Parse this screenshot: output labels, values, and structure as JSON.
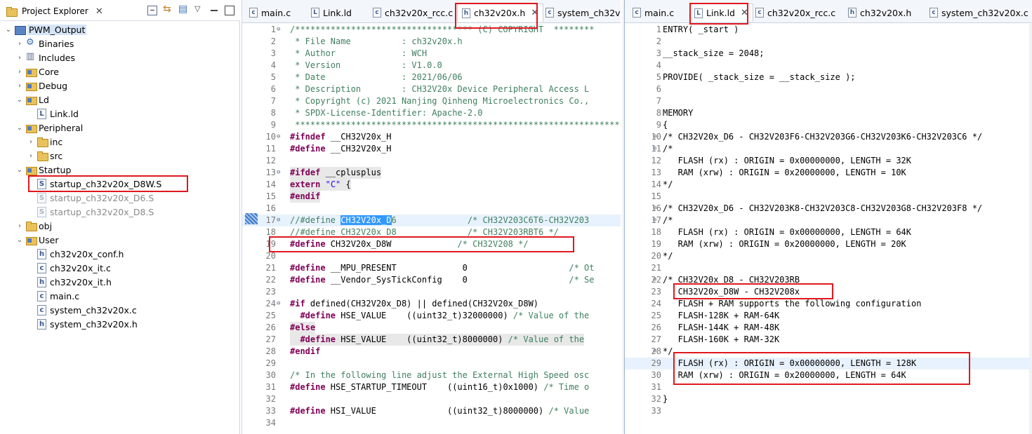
{
  "project_explorer": {
    "title": "Project Explorer",
    "close_glyph": "✕",
    "items": [
      {
        "label": "PWM_Output",
        "icon": "project-icon",
        "arrow": "⌄"
      },
      {
        "label": "Binaries",
        "icon": "binaries-icon",
        "arrow": "›"
      },
      {
        "label": "Includes",
        "icon": "includes-icon",
        "arrow": "›"
      },
      {
        "label": "Core",
        "icon": "source-folder-icon",
        "arrow": "›"
      },
      {
        "label": "Debug",
        "icon": "source-folder-icon",
        "arrow": "›"
      },
      {
        "label": "Ld",
        "icon": "source-folder-icon",
        "arrow": "⌄"
      },
      {
        "label": "Link.ld",
        "icon": "file-icon",
        "glyph": "L"
      },
      {
        "label": "Peripheral",
        "icon": "source-folder-icon",
        "arrow": "⌄"
      },
      {
        "label": "inc",
        "icon": "folder-icon",
        "arrow": "›"
      },
      {
        "label": "src",
        "icon": "folder-icon",
        "arrow": "›"
      },
      {
        "label": "Startup",
        "icon": "source-folder-icon",
        "arrow": "⌄"
      },
      {
        "label": "startup_ch32v20x_D8W.S",
        "icon": "asm-file-icon",
        "glyph": "S"
      },
      {
        "label": "startup_ch32v20x_D6.S",
        "icon": "asm-file-icon",
        "glyph": "S"
      },
      {
        "label": "startup_ch32v20x_D8.S",
        "icon": "asm-file-icon",
        "glyph": "S"
      },
      {
        "label": "obj",
        "icon": "folder-icon",
        "arrow": "›"
      },
      {
        "label": "User",
        "icon": "source-folder-icon",
        "arrow": "⌄"
      },
      {
        "label": "ch32v20x_conf.h",
        "icon": "header-file-icon",
        "glyph": "h"
      },
      {
        "label": "ch32v20x_it.c",
        "icon": "c-file-icon",
        "glyph": "c"
      },
      {
        "label": "ch32v20x_it.h",
        "icon": "header-file-icon",
        "glyph": "h"
      },
      {
        "label": "main.c",
        "icon": "c-file-icon",
        "glyph": "c"
      },
      {
        "label": "system_ch32v20x.c",
        "icon": "c-file-icon",
        "glyph": "c"
      },
      {
        "label": "system_ch32v20x.h",
        "icon": "header-file-icon",
        "glyph": "h"
      }
    ]
  },
  "left_editor": {
    "tabs": [
      {
        "label": "main.c",
        "glyph": "c"
      },
      {
        "label": "Link.ld",
        "glyph": "L"
      },
      {
        "label": "ch32v20x_rcc.c",
        "glyph": "c"
      },
      {
        "label": "ch32v20x.h",
        "glyph": "h",
        "close": "✕"
      },
      {
        "label": "system_ch32v20x",
        "glyph": "c"
      }
    ],
    "lines": [
      {
        "n": "1",
        "fold": "⊖",
        "t": "/*********************************** (C) COPYRIGHT  ********"
      },
      {
        "n": "2",
        "t": " * File Name          : ch32v20x.h"
      },
      {
        "n": "3",
        "t": " * Author             : WCH"
      },
      {
        "n": "4",
        "t": " * Version            : V1.0.0"
      },
      {
        "n": "5",
        "t": " * Date               : 2021/06/06"
      },
      {
        "n": "6",
        "t": " * Description        : CH32V20x Device Peripheral Access L"
      },
      {
        "n": "7",
        "t": " * Copyright (c) 2021 Nanjing Qinheng Microelectronics Co.,"
      },
      {
        "n": "8",
        "t": " * SPDX-License-Identifier: Apache-2.0"
      },
      {
        "n": "9",
        "t": " *******************************************************************"
      },
      {
        "n": "10",
        "fold": "⊖",
        "t": "#ifndef __CH32V20x_H"
      },
      {
        "n": "11",
        "t": "#define __CH32V20x_H"
      },
      {
        "n": "12",
        "t": ""
      },
      {
        "n": "13",
        "fold": "⊖",
        "t": "#ifdef __cplusplus"
      },
      {
        "n": "14",
        "t": "extern \"C\" {"
      },
      {
        "n": "15",
        "t": "#endif"
      },
      {
        "n": "16",
        "t": ""
      },
      {
        "n": "17",
        "fold": "⊖",
        "t": "//#define CH32V20x_D6              /* CH32V203C6T6-CH32V203"
      },
      {
        "n": "18",
        "t": "//#define CH32V20x_D8              /* CH32V203RBT6 */"
      },
      {
        "n": "19",
        "t": "#define CH32V20x_D8W             /* CH32V208 */"
      },
      {
        "n": "20",
        "t": ""
      },
      {
        "n": "21",
        "t": "#define __MPU_PRESENT             0                    /* Ot"
      },
      {
        "n": "22",
        "t": "#define __Vendor_SysTickConfig    0                    /* Se"
      },
      {
        "n": "23",
        "t": ""
      },
      {
        "n": "24",
        "fold": "⊖",
        "t": "#if defined(CH32V20x_D8) || defined(CH32V20x_D8W)"
      },
      {
        "n": "25",
        "t": "  #define HSE_VALUE    ((uint32_t)32000000) /* Value of the"
      },
      {
        "n": "26",
        "t": "#else"
      },
      {
        "n": "27",
        "t": "  #define HSE_VALUE    ((uint32_t)8000000) /* Value of the"
      },
      {
        "n": "28",
        "t": "#endif"
      },
      {
        "n": "29",
        "t": ""
      },
      {
        "n": "30",
        "t": "/* In the following line adjust the External High Speed osc"
      },
      {
        "n": "31",
        "t": "#define HSE_STARTUP_TIMEOUT    ((uint16_t)0x1000) /* Time o"
      },
      {
        "n": "32",
        "t": ""
      },
      {
        "n": "33",
        "t": "#define HSI_VALUE              ((uint32_t)8000000) /* Value"
      },
      {
        "n": "34",
        "t": ""
      }
    ],
    "selection": "CH32V20x_D"
  },
  "right_editor": {
    "tabs": [
      {
        "label": "main.c",
        "glyph": "c"
      },
      {
        "label": "Link.ld",
        "glyph": "L",
        "close": "✕"
      },
      {
        "label": "ch32v20x_rcc.c",
        "glyph": "c"
      },
      {
        "label": "ch32v20x.h",
        "glyph": "h"
      },
      {
        "label": "system_ch32v20x.c",
        "glyph": "c"
      }
    ],
    "lines": [
      {
        "n": "1",
        "t": "ENTRY( _start )"
      },
      {
        "n": "2",
        "t": ""
      },
      {
        "n": "3",
        "t": "__stack_size = 2048;"
      },
      {
        "n": "4",
        "t": ""
      },
      {
        "n": "5",
        "t": "PROVIDE( _stack_size = __stack_size );"
      },
      {
        "n": "6",
        "t": ""
      },
      {
        "n": "7",
        "t": ""
      },
      {
        "n": "8",
        "t": "MEMORY"
      },
      {
        "n": "9",
        "t": "{"
      },
      {
        "n": "10",
        "fold": "⊖",
        "t": "/* CH32V20x_D6 - CH32V203F6-CH32V203G6-CH32V203K6-CH32V203C6 */"
      },
      {
        "n": "11",
        "fold": "⊖",
        "t": "/*"
      },
      {
        "n": "12",
        "t": "   FLASH (rx) : ORIGIN = 0x00000000, LENGTH = 32K"
      },
      {
        "n": "13",
        "t": "   RAM (xrw) : ORIGIN = 0x20000000, LENGTH = 10K"
      },
      {
        "n": "14",
        "t": "*/"
      },
      {
        "n": "15",
        "t": ""
      },
      {
        "n": "16",
        "fold": "⊖",
        "t": "/* CH32V20x_D6 - CH32V203K8-CH32V203C8-CH32V203G8-CH32V203F8 */"
      },
      {
        "n": "17",
        "fold": "⊖",
        "t": "/*"
      },
      {
        "n": "18",
        "t": "   FLASH (rx) : ORIGIN = 0x00000000, LENGTH = 64K"
      },
      {
        "n": "19",
        "t": "   RAM (xrw) : ORIGIN = 0x20000000, LENGTH = 20K"
      },
      {
        "n": "20",
        "t": "*/"
      },
      {
        "n": "21",
        "t": ""
      },
      {
        "n": "22",
        "fold": "⊖",
        "t": "/* CH32V20x D8 - CH32V203RB"
      },
      {
        "n": "23",
        "t": "   CH32V20x_D8W - CH32V208x"
      },
      {
        "n": "24",
        "t": "   FLASH + RAM supports the following configuration"
      },
      {
        "n": "25",
        "t": "   FLASH-128K + RAM-64K"
      },
      {
        "n": "26",
        "t": "   FLASH-144K + RAM-48K"
      },
      {
        "n": "27",
        "t": "   FLASH-160K + RAM-32K"
      },
      {
        "n": "28",
        "fold": "⊖",
        "t": "*/"
      },
      {
        "n": "29",
        "t": "   FLASH (rx) : ORIGIN = 0x00000000, LENGTH = 128K"
      },
      {
        "n": "30",
        "t": "   RAM (xrw) : ORIGIN = 0x20000000, LENGTH = 64K"
      },
      {
        "n": "31",
        "t": ""
      },
      {
        "n": "32",
        "t": "}"
      },
      {
        "n": "33",
        "t": ""
      }
    ]
  },
  "colors": {
    "highlight_box": "#e0181e",
    "comment": "#3f7f5f",
    "keyword": "#7f0055",
    "string": "#2a00ff",
    "selection": "#3399ff"
  }
}
